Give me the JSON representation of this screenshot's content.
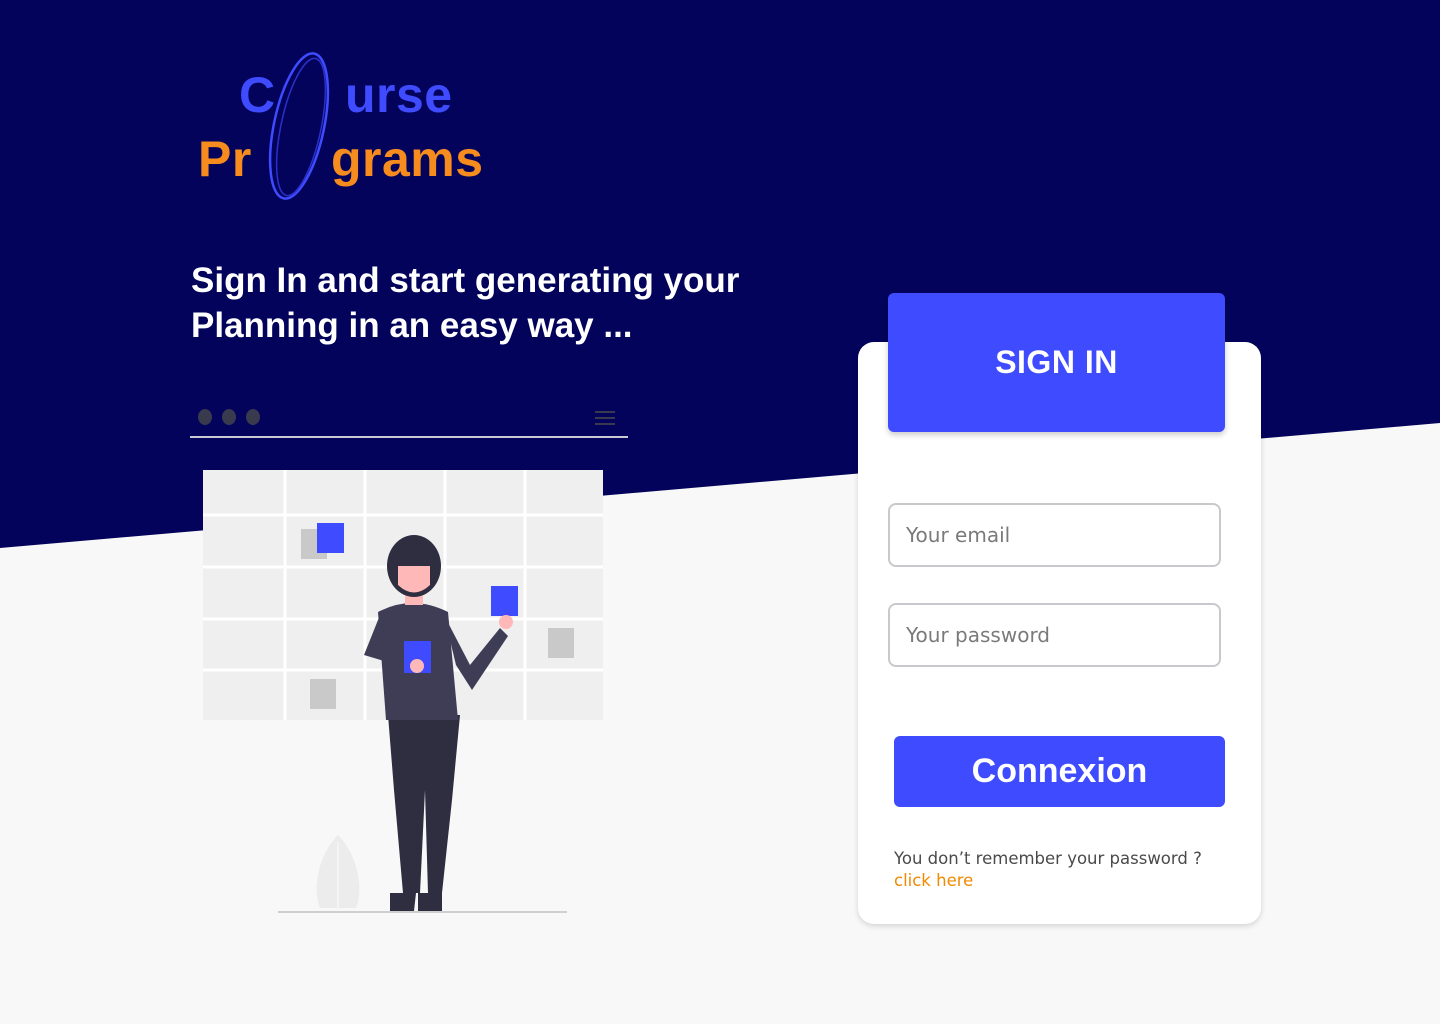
{
  "logo": {
    "line1_part1": "C",
    "line1_part2": "urse",
    "line2_part1": "Pr",
    "line2_part2": "grams",
    "blue": "#3f4bff",
    "orange": "#f68b1e"
  },
  "headline": {
    "line1": "Sign In and start generating your",
    "line2": "Planning in an easy way ..."
  },
  "colors": {
    "navy": "#03035c",
    "accent": "#3f4bff",
    "link": "#f08a00",
    "page_bg": "#f8f8f8"
  },
  "illustration": {
    "icon_menu": "hamburger-menu-icon",
    "window_dots": 3
  },
  "form": {
    "title": "SIGN IN",
    "email_placeholder": "Your email",
    "password_placeholder": "Your password",
    "submit_label": "Connexion",
    "forgot_text": "You don’t remember your password ?",
    "forgot_link": "click here"
  }
}
